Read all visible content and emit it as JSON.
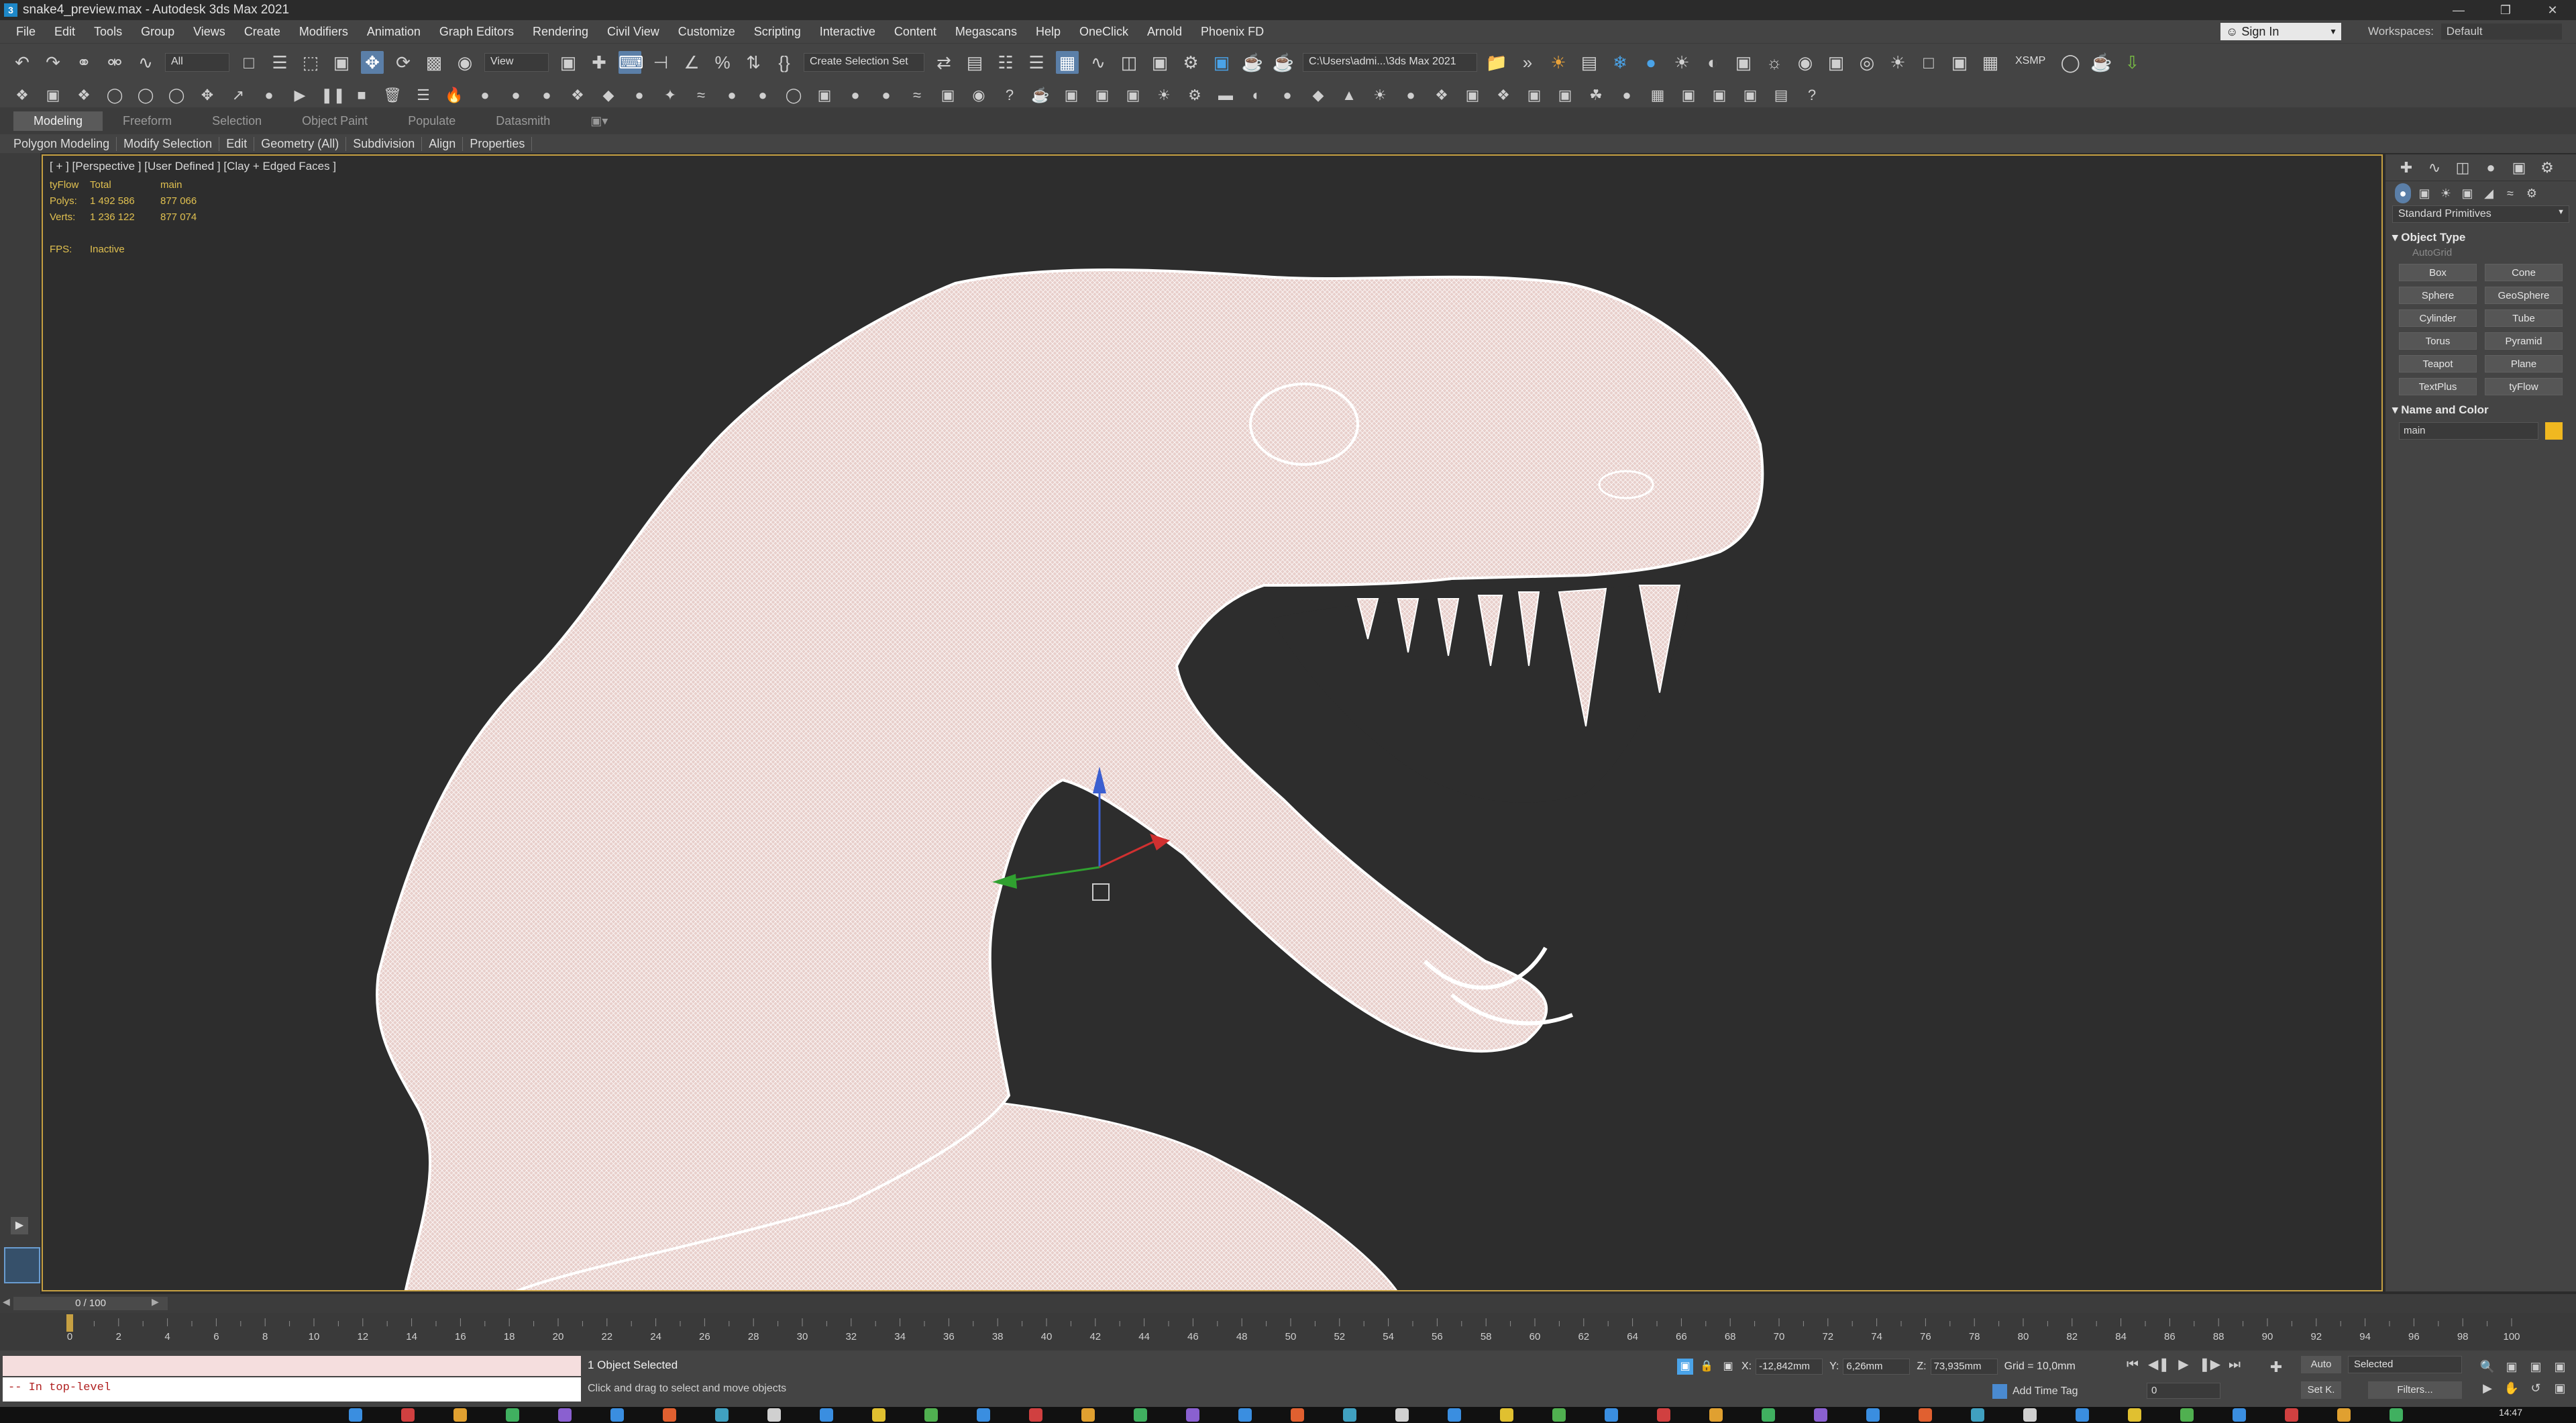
{
  "window": {
    "title": "snake4_preview.max - Autodesk 3ds Max 2021",
    "app_icon": "3"
  },
  "menu": {
    "items": [
      "File",
      "Edit",
      "Tools",
      "Group",
      "Views",
      "Create",
      "Modifiers",
      "Animation",
      "Graph Editors",
      "Rendering",
      "Civil View",
      "Customize",
      "Scripting",
      "Interactive",
      "Content",
      "Megascans",
      "Help",
      "OneClick",
      "Arnold",
      "Phoenix FD"
    ],
    "sign_in": "Sign In",
    "workspaces_label": "Workspaces:",
    "workspaces_value": "Default"
  },
  "toolbar": {
    "selection_filter": "All",
    "ref_coord": "View",
    "named_selection": "Create Selection Set",
    "project_path": "C:\\Users\\admi...\\3ds Max 2021",
    "xsmp": "XSMP"
  },
  "ribbon": {
    "tabs": [
      "Modeling",
      "Freeform",
      "Selection",
      "Object Paint",
      "Populate",
      "Datasmith"
    ],
    "active_tab": "Modeling",
    "subtabs": [
      "Polygon Modeling",
      "Modify Selection",
      "Edit",
      "Geometry (All)",
      "Subdivision",
      "Align",
      "Properties"
    ]
  },
  "viewport": {
    "label": "[ + ] [Perspective ] [User Defined ] [Clay + Edged Faces ]",
    "stats": {
      "header": [
        "tyFlow",
        "Total",
        "main"
      ],
      "polys_label": "Polys:",
      "polys_total": "1 492 586",
      "polys_main": "877 066",
      "verts_label": "Verts:",
      "verts_total": "1 236 122",
      "verts_main": "877 074",
      "fps_label": "FPS:",
      "fps_value": "Inactive"
    },
    "mesh_color": "#e8cfcb",
    "wire_color": "#ffffff",
    "border_color": "#c6a042"
  },
  "command_panel": {
    "primitive_type": "Standard Primitives",
    "object_type_title": "Object Type",
    "autogrid": "AutoGrid",
    "primitives": [
      "Box",
      "Cone",
      "Sphere",
      "GeoSphere",
      "Cylinder",
      "Tube",
      "Torus",
      "Pyramid",
      "Teapot",
      "Plane",
      "TextPlus",
      "tyFlow"
    ],
    "name_color_title": "Name and Color",
    "object_name": "main",
    "object_color": "#f0b820"
  },
  "timeline": {
    "frame_display": "0 / 100",
    "ticks": [
      0,
      2,
      4,
      6,
      8,
      10,
      12,
      14,
      16,
      18,
      20,
      22,
      24,
      26,
      28,
      30,
      32,
      34,
      36,
      38,
      40,
      42,
      44,
      46,
      48,
      50,
      52,
      54,
      56,
      58,
      60,
      62,
      64,
      66,
      68,
      70,
      72,
      74,
      76,
      78,
      80,
      82,
      84,
      86,
      88,
      90,
      92,
      94,
      96,
      98,
      100
    ],
    "current_frame": 0
  },
  "status": {
    "maxscript_output": "-- In top-level",
    "selection": "1 Object Selected",
    "hint": "Click and drag to select and move objects",
    "x_label": "X:",
    "x_value": "-12,842mm",
    "y_label": "Y:",
    "y_value": "6,26mm",
    "z_label": "Z:",
    "z_value": "73,935mm",
    "grid": "Grid = 10,0mm",
    "add_time_tag": "Add Time Tag",
    "frame_value": "0",
    "auto": "Auto",
    "set_k": "Set K.",
    "selected": "Selected",
    "filters": "Filters...",
    "clock": "14:47"
  }
}
